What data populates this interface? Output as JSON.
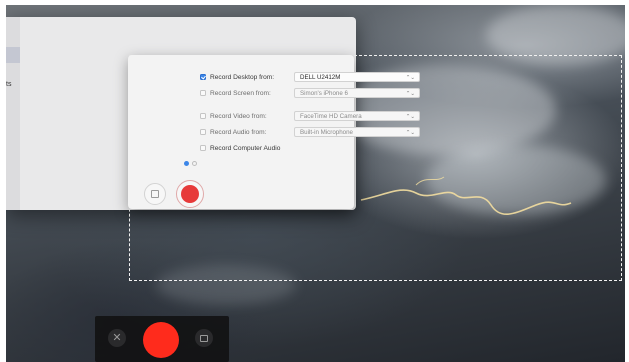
{
  "side_label": "ts",
  "options": [
    {
      "label": "Record Desktop from:",
      "checked": true,
      "value": "DELL U2412M",
      "enabled": true
    },
    {
      "label": "Record Screen from:",
      "checked": false,
      "value": "Simon's iPhone 6",
      "enabled": false
    },
    {
      "label": "Record Video from:",
      "checked": false,
      "value": "FaceTime HD Camera",
      "enabled": false
    },
    {
      "label": "Record Audio from:",
      "checked": false,
      "value": "Built-in Microphone",
      "enabled": false
    },
    {
      "label": "Record Computer Audio",
      "checked": false,
      "enabled": true
    }
  ],
  "page_dots": {
    "count": 2,
    "active": 0
  },
  "icons": {
    "checkbox": "checkbox",
    "popup_chevron": "⌃⌄",
    "stop": "stop-square-icon",
    "record": "record-icon",
    "close": "✕",
    "window_capture": "window-capture-icon"
  },
  "colors": {
    "accent": "#3b86e8",
    "record": "#e73a3a",
    "record_bar": "#ff2b1c"
  }
}
